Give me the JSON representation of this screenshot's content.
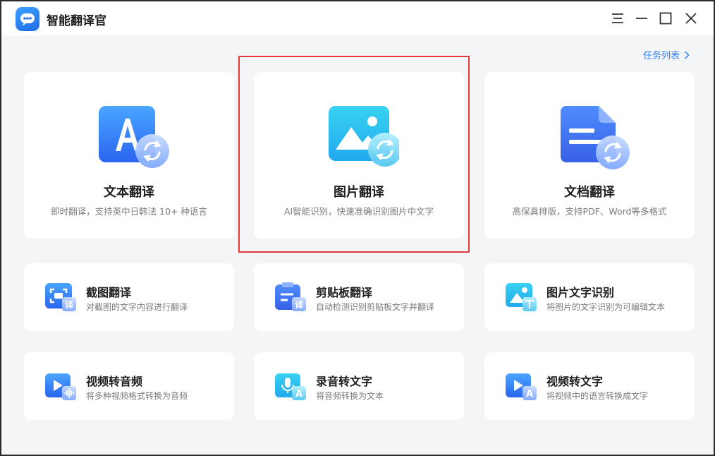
{
  "app": {
    "title": "智能翻译官",
    "logo_icon": "chat-bubble-logo-icon"
  },
  "window_controls": [
    "menu-icon",
    "minimize-icon",
    "maximize-icon",
    "close-icon"
  ],
  "header": {
    "task_list_label": "任务列表"
  },
  "feature_cards": [
    {
      "title": "文本翻译",
      "desc": "即时翻译，支持英中日韩法 10+ 种语言",
      "icon": "text-translate-icon"
    },
    {
      "title": "图片翻译",
      "desc": "AI智能识别，快速准确识别图片中文字",
      "icon": "image-translate-icon"
    },
    {
      "title": "文档翻译",
      "desc": "高保真排版，支持PDF、Word等多格式",
      "icon": "document-translate-icon"
    }
  ],
  "tool_cards": [
    {
      "title": "截图翻译",
      "desc": "对截图的文字内容进行翻译",
      "icon": "screenshot-translate-icon"
    },
    {
      "title": "剪贴板翻译",
      "desc": "自动检测识别剪贴板文字并翻译",
      "icon": "clipboard-translate-icon"
    },
    {
      "title": "图片文字识别",
      "desc": "将图片的文字识别为可编辑文本",
      "icon": "image-ocr-icon"
    },
    {
      "title": "视频转音频",
      "desc": "将多种视频格式转换为音频",
      "icon": "video-to-audio-icon"
    },
    {
      "title": "录音转文字",
      "desc": "将音频转换为文本",
      "icon": "audio-to-text-icon"
    },
    {
      "title": "视频转文字",
      "desc": "将视频中的语言转换成文字",
      "icon": "video-to-text-icon"
    }
  ],
  "colors": {
    "accent": "#2f7cf6",
    "highlight": "#e23a3a",
    "background": "#f4f5f7"
  }
}
